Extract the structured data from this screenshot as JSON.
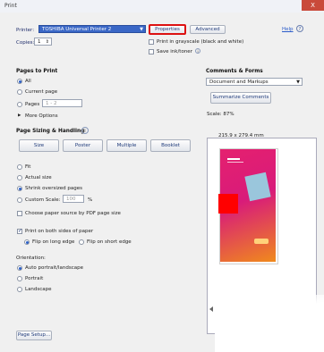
{
  "window": {
    "title": "Print",
    "close_glyph": "X"
  },
  "printer": {
    "label": "Printer:",
    "value": "TOSHIBA Universal Printer 2",
    "properties_label": "Properties",
    "advanced_label": "Advanced",
    "help_label": "Help",
    "help_icon": "help-circle-icon"
  },
  "copies": {
    "label": "Copies:",
    "value": "1"
  },
  "options": {
    "grayscale_label": "Print in grayscale (black and white)",
    "save_ink_label": "Save ink/toner"
  },
  "pages_to_print": {
    "heading": "Pages to Print",
    "all_label": "All",
    "current_label": "Current page",
    "pages_label": "Pages",
    "pages_value": "1 - 2",
    "more_label": "More Options"
  },
  "sizing": {
    "heading": "Page Sizing & Handling",
    "tabs": [
      "Size",
      "Poster",
      "Multiple",
      "Booklet"
    ],
    "fit_label": "Fit",
    "actual_label": "Actual size",
    "shrink_label": "Shrink oversized pages",
    "custom_label": "Custom Scale:",
    "custom_value": "100",
    "custom_unit": "%",
    "paper_source_label": "Choose paper source by PDF page size"
  },
  "duplex": {
    "both_sides_label": "Print on both sides of paper",
    "long_edge_label": "Flip on long edge",
    "short_edge_label": "Flip on short edge"
  },
  "orientation": {
    "heading": "Orientation:",
    "auto_label": "Auto portrait/landscape",
    "portrait_label": "Portrait",
    "landscape_label": "Landscape"
  },
  "comments": {
    "heading": "Comments & Forms",
    "value": "Document and Markups",
    "summarize_label": "Summarize Comments",
    "scale_label": "Scale: 87%",
    "page_size": "215.9 x 279.4 mm"
  },
  "footer": {
    "page_setup_label": "Page Setup..."
  }
}
